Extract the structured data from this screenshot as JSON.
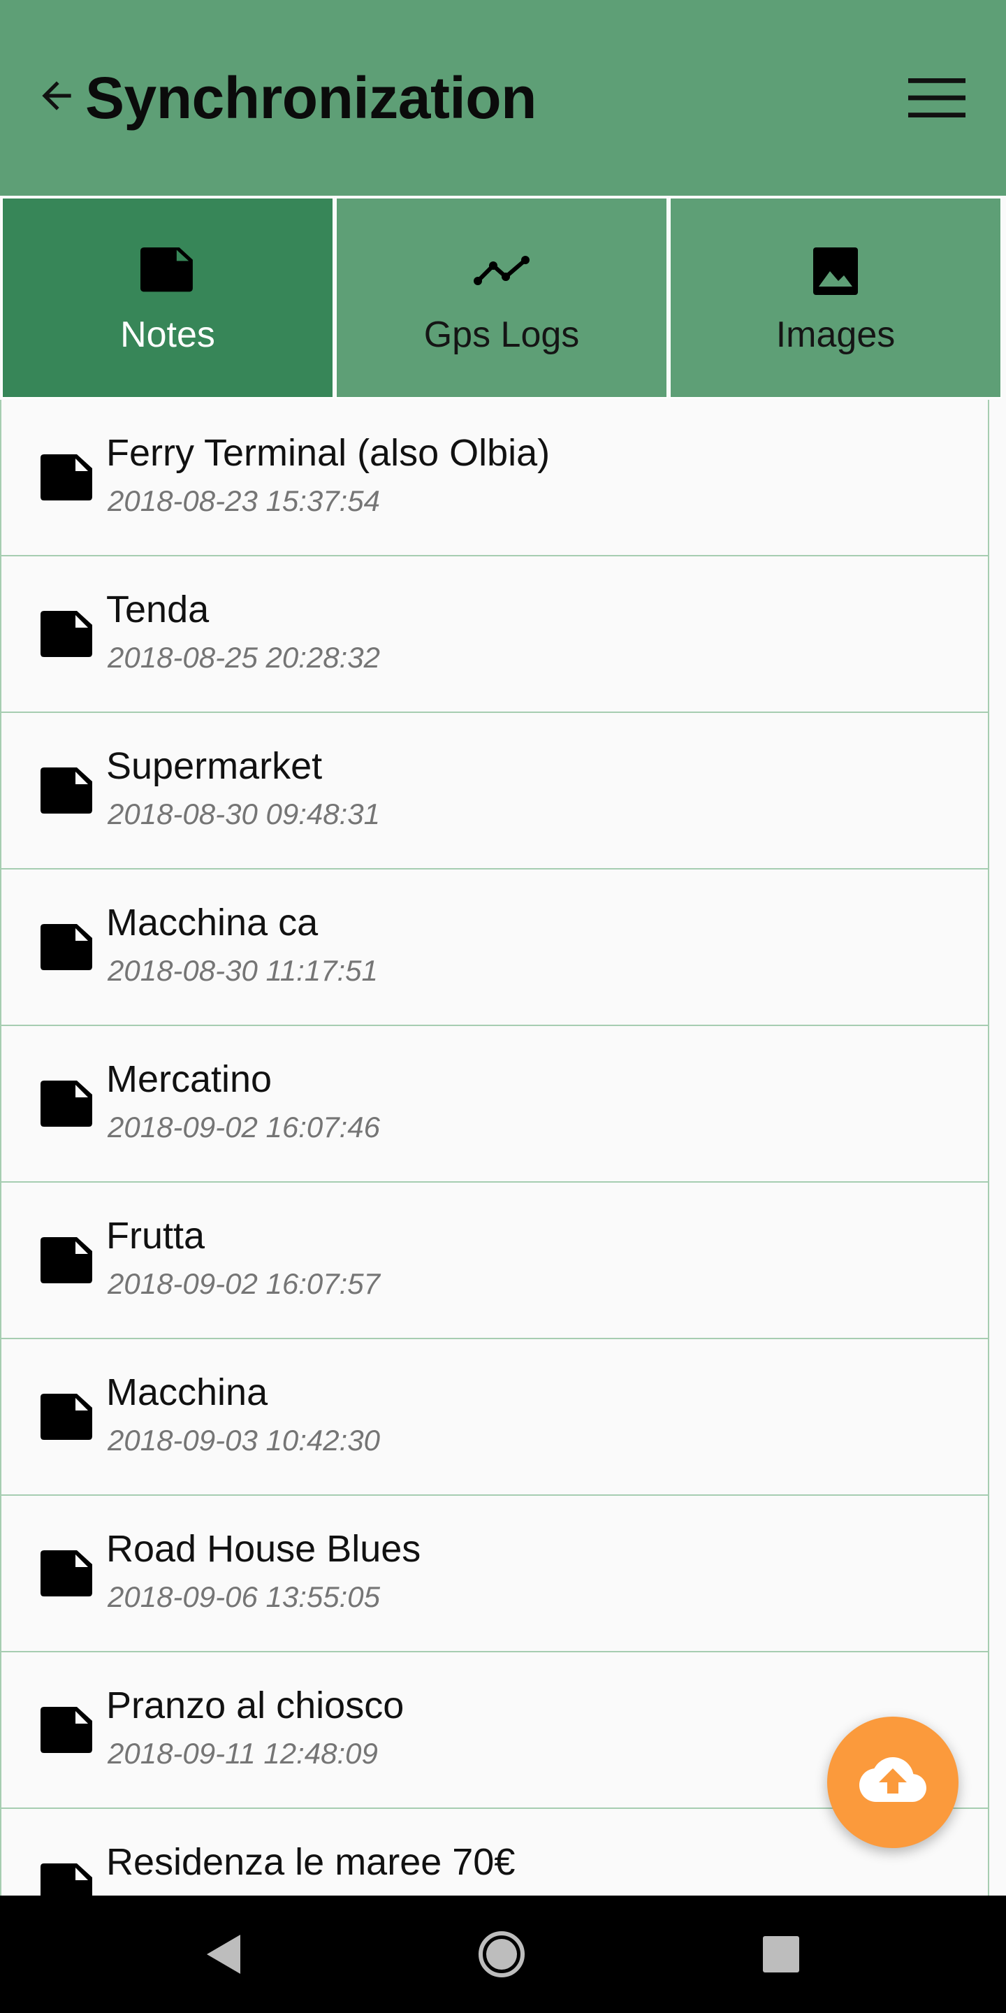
{
  "app_bar": {
    "title": "Synchronization",
    "background_color": "#5e9f76",
    "back_icon": "arrow-back-icon",
    "menu_icon": "hamburger-menu-icon"
  },
  "tabs": [
    {
      "label": "Notes",
      "icon": "note-icon",
      "active": true
    },
    {
      "label": "Gps Logs",
      "icon": "timeline-icon",
      "active": false
    },
    {
      "label": "Images",
      "icon": "image-icon",
      "active": false
    }
  ],
  "notes": [
    {
      "title": "Ferry Terminal (also Olbia)",
      "date": "2018-08-23 15:37:54"
    },
    {
      "title": "Tenda",
      "date": "2018-08-25 20:28:32"
    },
    {
      "title": "Supermarket",
      "date": "2018-08-30 09:48:31"
    },
    {
      "title": "Macchina ca",
      "date": "2018-08-30 11:17:51"
    },
    {
      "title": "Mercatino",
      "date": "2018-09-02 16:07:46"
    },
    {
      "title": "Frutta",
      "date": "2018-09-02 16:07:57"
    },
    {
      "title": "Macchina",
      "date": "2018-09-03 10:42:30"
    },
    {
      "title": "Road House Blues",
      "date": "2018-09-06 13:55:05"
    },
    {
      "title": "Pranzo al chiosco",
      "date": "2018-09-11 12:48:09"
    },
    {
      "title": "Residenza le maree 70€",
      "date": ""
    }
  ],
  "fab": {
    "icon": "cloud-upload-icon",
    "color": "#fb9a3c"
  },
  "colors": {
    "tab_active": "#378658",
    "tab_inactive": "#5e9f76",
    "divider": "#a6cdb1"
  },
  "system_nav": {
    "buttons": [
      "back-icon",
      "home-icon",
      "recents-icon"
    ]
  }
}
